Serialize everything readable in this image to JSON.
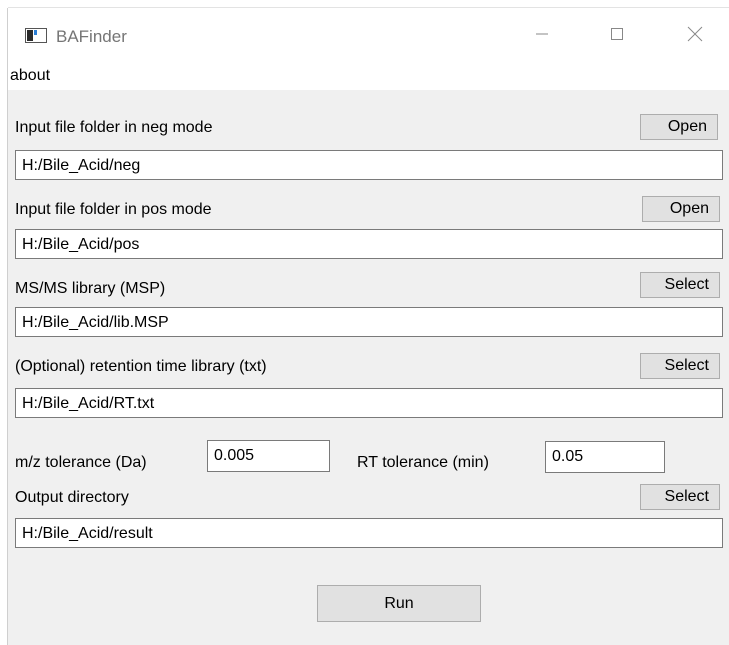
{
  "window": {
    "title": "BAFinder",
    "controls": {
      "minimize": "minimize-icon",
      "maximize": "maximize-icon",
      "close": "close-icon"
    }
  },
  "menu": {
    "about": "about"
  },
  "neg": {
    "label": "Input file folder in neg mode",
    "button": "Open",
    "value": "H:/Bile_Acid/neg"
  },
  "pos": {
    "label": "Input file folder in pos mode",
    "button": "Open",
    "value": "H:/Bile_Acid/pos"
  },
  "msms": {
    "label": "MS/MS library (MSP)",
    "button": "Select",
    "value": "H:/Bile_Acid/lib.MSP"
  },
  "rtlib": {
    "label": "(Optional) retention time library (txt)",
    "button": "Select",
    "value": "H:/Bile_Acid/RT.txt"
  },
  "tolerance": {
    "mz_label": "m/z tolerance (Da)",
    "mz_value": "0.005",
    "rt_label": "RT tolerance (min)",
    "rt_value": "0.05"
  },
  "output": {
    "label": "Output directory",
    "button": "Select",
    "value": "H:/Bile_Acid/result"
  },
  "run": {
    "label": "Run"
  }
}
